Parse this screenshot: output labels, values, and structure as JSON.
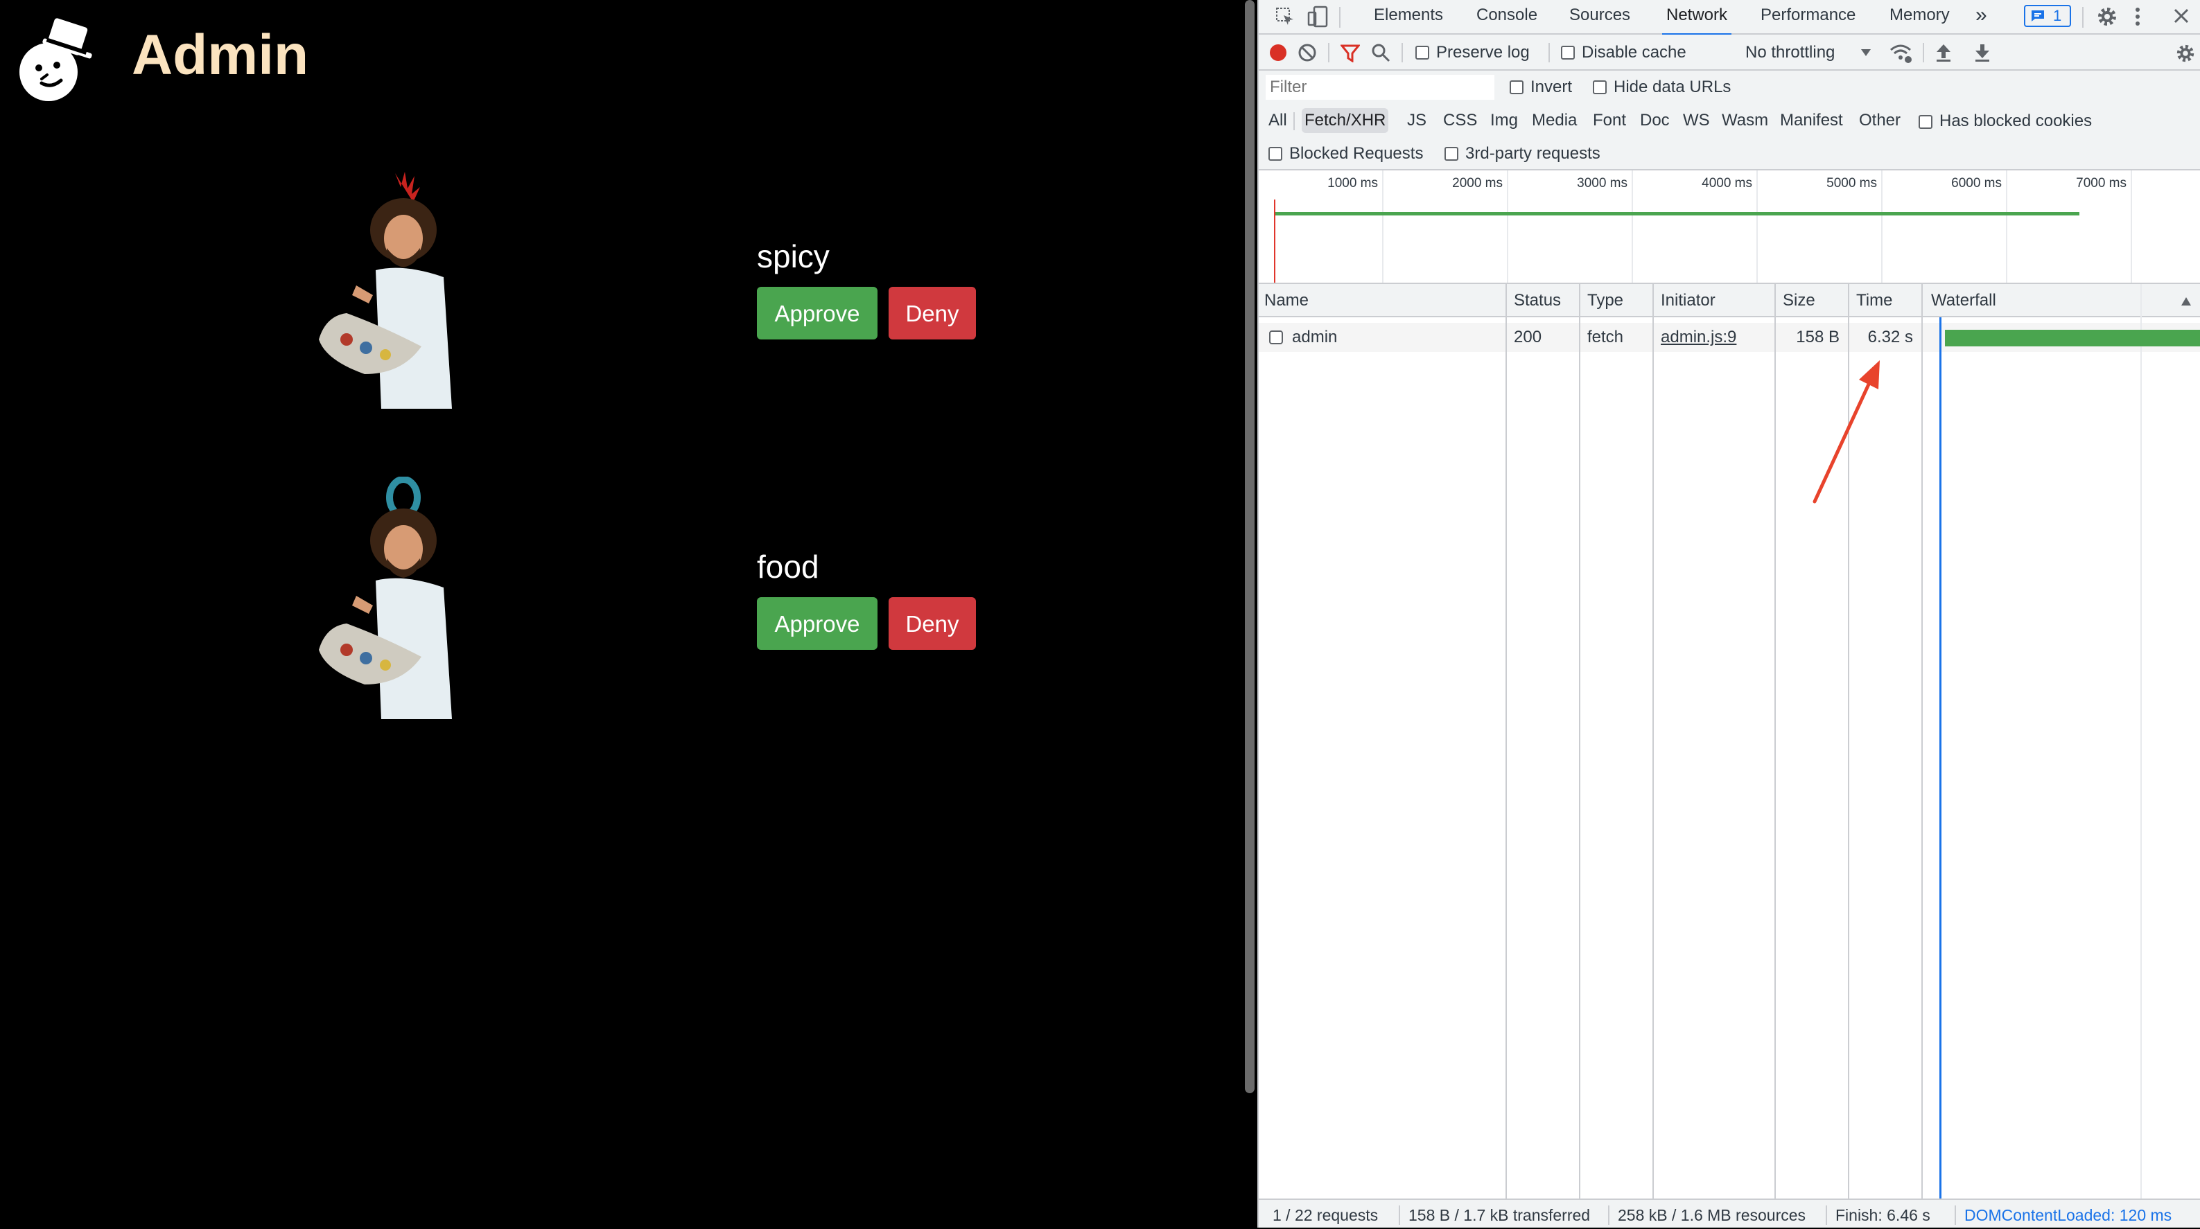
{
  "app": {
    "title": "Admin",
    "items": [
      {
        "name": "spicy",
        "approve_label": "Approve",
        "deny_label": "Deny"
      },
      {
        "name": "food",
        "approve_label": "Approve",
        "deny_label": "Deny"
      }
    ]
  },
  "devtools": {
    "tabs": [
      "Elements",
      "Console",
      "Sources",
      "Network",
      "Performance",
      "Memory"
    ],
    "active_tab": "Network",
    "more_tabs": "»",
    "issues_count": "1",
    "toolbar": {
      "preserve_log": "Preserve log",
      "disable_cache": "Disable cache",
      "throttling": "No throttling"
    },
    "filter": {
      "placeholder": "Filter",
      "invert": "Invert",
      "hide_data_urls": "Hide data URLs"
    },
    "types": [
      "All",
      "Fetch/XHR",
      "JS",
      "CSS",
      "Img",
      "Media",
      "Font",
      "Doc",
      "WS",
      "Wasm",
      "Manifest",
      "Other"
    ],
    "active_type": "Fetch/XHR",
    "has_blocked_cookies": "Has blocked cookies",
    "blocked_requests": "Blocked Requests",
    "third_party": "3rd-party requests",
    "overview_ticks": [
      "1000 ms",
      "2000 ms",
      "3000 ms",
      "4000 ms",
      "5000 ms",
      "6000 ms",
      "7000 ms"
    ],
    "columns": {
      "name": "Name",
      "status": "Status",
      "type": "Type",
      "initiator": "Initiator",
      "size": "Size",
      "time": "Time",
      "waterfall": "Waterfall"
    },
    "rows": [
      {
        "name": "admin",
        "status": "200",
        "type": "fetch",
        "initiator": "admin.js:9",
        "size": "158 B",
        "time": "6.32 s"
      }
    ],
    "status_bar": {
      "requests": "1 / 22 requests",
      "transferred": "158 B / 1.7 kB transferred",
      "resources": "258 kB / 1.6 MB resources",
      "finish": "Finish: 6.46 s",
      "dom_content_loaded": "DOMContentLoaded: 120 ms"
    }
  },
  "colors": {
    "title": "#fbe3bf",
    "approve": "#4aa54f",
    "deny": "#d0393e",
    "active_tab": "#1a73e8",
    "annotation_arrow": "#e8432c"
  },
  "icons": [
    "snowman-logo-icon",
    "inspect-icon",
    "device-toggle-icon",
    "settings-gear-icon",
    "kebab-menu-icon",
    "close-icon",
    "record-icon",
    "clear-icon",
    "filter-icon",
    "search-icon",
    "network-conditions-icon",
    "upload-icon",
    "download-icon",
    "sort-up-icon"
  ]
}
